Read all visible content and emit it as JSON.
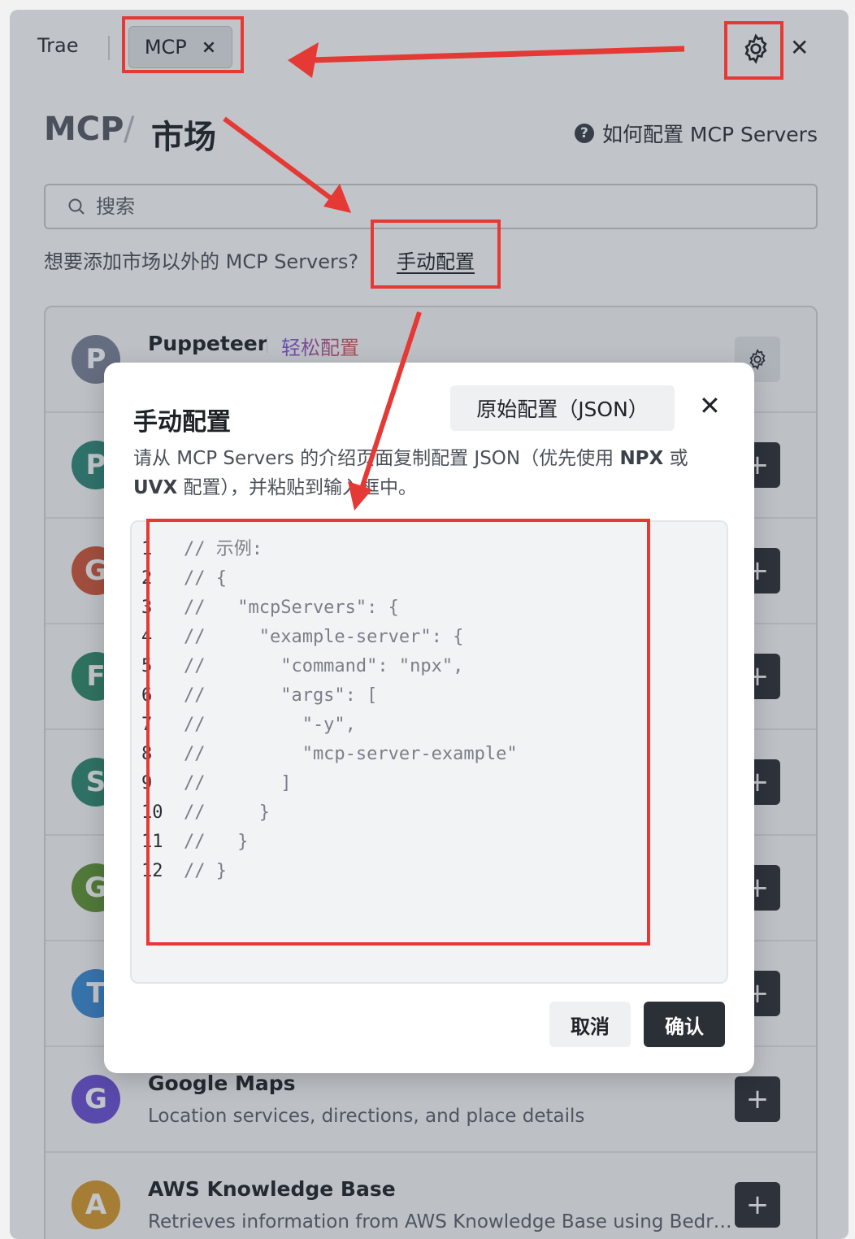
{
  "tabs": [
    {
      "label": "Trae"
    },
    {
      "label": "MCP",
      "close": "×"
    }
  ],
  "top_close": "✕",
  "breadcrumb": {
    "root": "MCP",
    "sep": "/",
    "current": "市场"
  },
  "help": {
    "icon": "?",
    "label": "如何配置 MCP Servers"
  },
  "search": {
    "placeholder": "搜索"
  },
  "hint": {
    "text": "想要添加市场以外的 MCP Servers?",
    "link": "手动配置"
  },
  "list": [
    {
      "avatar": "P",
      "color": "#7b8499",
      "title": "Puppeteer",
      "badge": "轻松配置",
      "desc": "",
      "action": "gear-icon"
    },
    {
      "avatar": "P",
      "color": "#2f8a7a",
      "title": "",
      "desc": "",
      "action": "+"
    },
    {
      "avatar": "G",
      "color": "#d3563a",
      "title": "",
      "desc": "",
      "action": "+"
    },
    {
      "avatar": "F",
      "color": "#2f8a6a",
      "title": "",
      "desc": "",
      "action": "+"
    },
    {
      "avatar": "S",
      "color": "#2f8a72",
      "title": "",
      "desc": "",
      "action": "+"
    },
    {
      "avatar": "G",
      "color": "#5f9434",
      "title": "",
      "desc": "",
      "action": "+"
    },
    {
      "avatar": "T",
      "color": "#3a8bd6",
      "title": "",
      "desc": "",
      "action": "+"
    },
    {
      "avatar": "G",
      "color": "#6a4fd6",
      "title": "Google Maps",
      "desc": "Location services, directions, and place details",
      "action": "+"
    },
    {
      "avatar": "A",
      "color": "#d89a2c",
      "title": "AWS Knowledge Base",
      "desc": "Retrieves information from AWS Knowledge Base using Bedr…",
      "action": "+"
    }
  ],
  "modal": {
    "title": "手动配置",
    "raw_button": "原始配置（JSON）",
    "close": "✕",
    "desc_parts": [
      "请从 MCP Servers 的介绍页面复制配置 JSON（优先使用 ",
      "NPX",
      " 或 ",
      "UVX",
      " 配置），并粘贴到输入框中。"
    ],
    "code": [
      "// 示例:",
      "// {",
      "//   \"mcpServers\": {",
      "//     \"example-server\": {",
      "//       \"command\": \"npx\",",
      "//       \"args\": [",
      "//         \"-y\",",
      "//         \"mcp-server-example\"",
      "//       ]",
      "//     }",
      "//   }",
      "// }"
    ],
    "cancel": "取消",
    "confirm": "确认"
  },
  "colors": {
    "annotation": "#e53935",
    "dark_button": "#2b2f36"
  }
}
